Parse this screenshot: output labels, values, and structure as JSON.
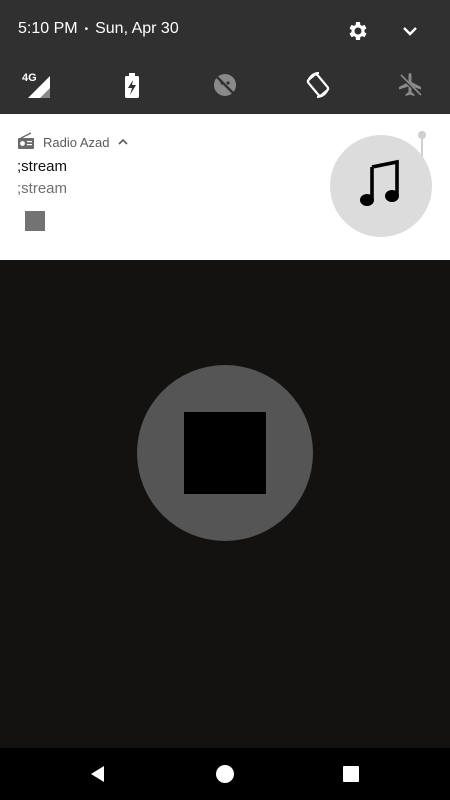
{
  "status_bar": {
    "time": "5:10 PM",
    "separator": "•",
    "date": "Sun, Apr 30",
    "icons": [
      "settings-gear-icon",
      "expand-chevron-icon"
    ]
  },
  "quick_settings": {
    "tiles": [
      {
        "name": "mobile-data-4g",
        "label": "4G"
      },
      {
        "name": "battery-saver"
      },
      {
        "name": "data-saver-off"
      },
      {
        "name": "auto-rotate"
      },
      {
        "name": "airplane-mode-off"
      }
    ]
  },
  "notification": {
    "app_name": "Radio Azad",
    "title": ";stream",
    "subtitle": ";stream",
    "action": "stop",
    "artwork_icon": "music-note-icon"
  },
  "player": {
    "main_action": "stop"
  },
  "colors": {
    "shade_bg": "#303030",
    "card_bg": "#ffffff",
    "app_bg": "#131211",
    "stop_circle": "#555555"
  }
}
